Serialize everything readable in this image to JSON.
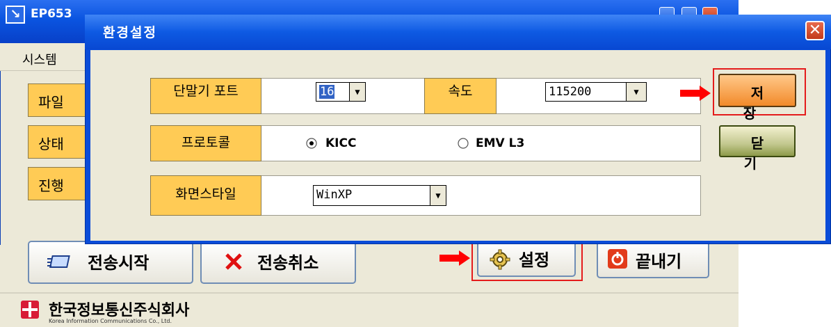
{
  "main_window": {
    "title": "EP653",
    "menu": [
      "시스템"
    ],
    "side_labels": [
      "파일",
      "상태",
      "진행"
    ],
    "buttons": {
      "start_transfer": "전송시작",
      "cancel_transfer": "전송취소",
      "settings": "설정",
      "exit": "끝내기"
    },
    "company": {
      "name": "한국정보통신주식회사",
      "name_en": "Korea Information Communications Co., Ltd."
    }
  },
  "dialog": {
    "title": "환경설정",
    "close_glyph": "✕",
    "port": {
      "label": "단말기 포트",
      "value": "16"
    },
    "speed": {
      "label": "속도",
      "value": "115200"
    },
    "protocol": {
      "label": "프로토콜",
      "options": [
        "KICC",
        "EMV L3"
      ],
      "selected": "KICC"
    },
    "style": {
      "label": "화면스타일",
      "value": "WinXP"
    },
    "save_label": "저 장",
    "close_label": "닫 기"
  },
  "colors": {
    "titlebar": "#0a54e0",
    "label_bg": "#ffcb55",
    "save_bg": "#f28a2a",
    "close_bg": "#c2c78e",
    "highlight": "#e41b1b"
  }
}
